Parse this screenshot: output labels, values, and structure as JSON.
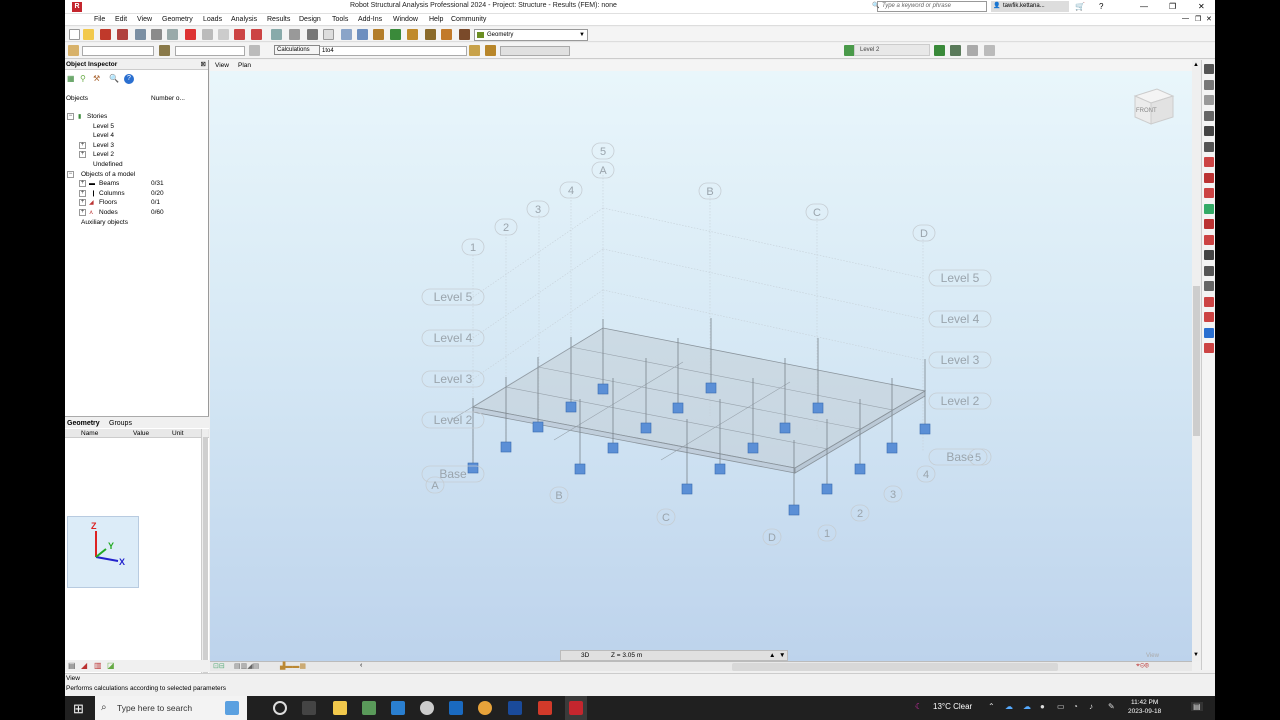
{
  "window": {
    "title": "Robot Structural Analysis Professional 2024 - Project: Structure - Results (FEM): none",
    "search_placeholder": "Type a keyword or phrase",
    "user": "tawfik.kettana...",
    "logo": "R"
  },
  "menu": [
    "File",
    "Edit",
    "View",
    "Geometry",
    "Loads",
    "Analysis",
    "Results",
    "Design",
    "Tools",
    "Add-Ins",
    "Window",
    "Help",
    "Community"
  ],
  "toolbar": {
    "geometry_select": "Geometry",
    "tooltip": "Calculations",
    "case_combo": "1to4",
    "level_select": "Level 2"
  },
  "inspector": {
    "title": "Object Inspector",
    "col_objects": "Objects",
    "col_number": "Number o...",
    "tree": [
      {
        "label": "Stories",
        "count": "",
        "level": 0,
        "expander": "−"
      },
      {
        "label": "Level 5",
        "count": "",
        "level": 2,
        "expander": ""
      },
      {
        "label": "Level 4",
        "count": "",
        "level": 2,
        "expander": ""
      },
      {
        "label": "Level 3",
        "count": "",
        "level": 2,
        "expander": "+"
      },
      {
        "label": "Level 2",
        "count": "",
        "level": 2,
        "expander": "+"
      },
      {
        "label": "Undefined",
        "count": "",
        "level": 2,
        "expander": ""
      },
      {
        "label": "Objects of a model",
        "count": "",
        "level": 0,
        "expander": "−"
      },
      {
        "label": "Beams",
        "count": "0/31",
        "level": 1,
        "expander": "+"
      },
      {
        "label": "Columns",
        "count": "0/20",
        "level": 1,
        "expander": "+"
      },
      {
        "label": "Floors",
        "count": "0/1",
        "level": 1,
        "expander": "+"
      },
      {
        "label": "Nodes",
        "count": "0/60",
        "level": 1,
        "expander": "+"
      },
      {
        "label": "Auxiliary objects",
        "count": "",
        "level": 0,
        "expander": ""
      }
    ],
    "props_tabs": [
      "Geometry",
      "Groups"
    ],
    "props_cols": [
      "Name",
      "Value",
      "Unit"
    ]
  },
  "view_tabs": [
    "View",
    "Plan"
  ],
  "viewport": {
    "grid_labels": {
      "numbers": [
        "5",
        "4",
        "3",
        "2",
        "1"
      ],
      "letters": [
        "A",
        "B",
        "C",
        "D"
      ],
      "levels_left": [
        "Level 5",
        "Level 4",
        "Level 3",
        "Level 2",
        "Base"
      ],
      "levels_right": [
        "Level 5",
        "Level 4",
        "Level 3",
        "Level 2",
        "Base"
      ],
      "front_letters": [
        "A",
        "B",
        "C",
        "D"
      ],
      "front_numbers": [
        "1",
        "2",
        "3",
        "4",
        "5"
      ]
    },
    "view_cube": "FRONT",
    "triad": {
      "z": "Z",
      "y": "Y",
      "x": "X"
    }
  },
  "status": {
    "mode": "3D",
    "z_value": "Z = 3.05 m",
    "view_label": "View",
    "line1": "View",
    "line2": "Performs calculations according to selected parameters"
  },
  "taskbar": {
    "search": "Type here to search",
    "weather": "13°C  Clear",
    "time": "11:42 PM",
    "date": "2023-09-18"
  }
}
